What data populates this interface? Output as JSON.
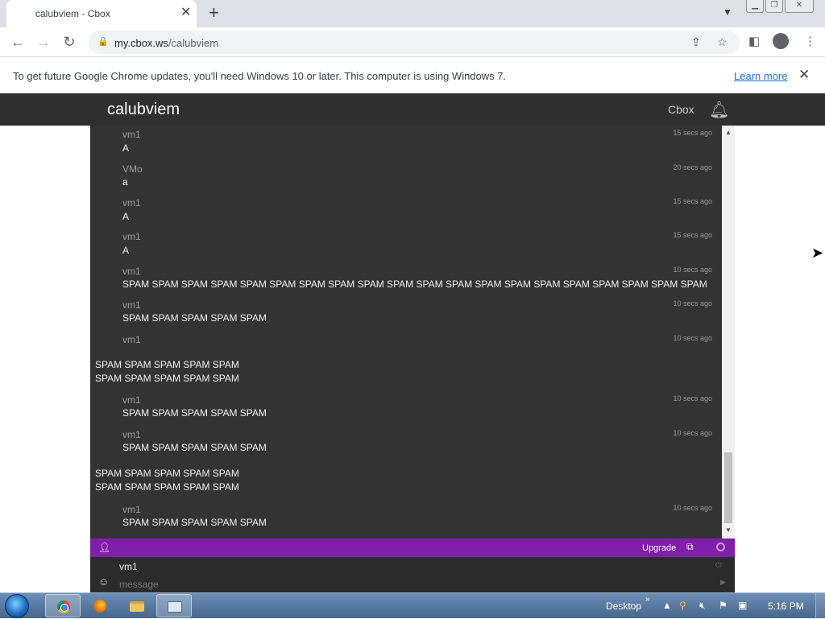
{
  "browser": {
    "tab_title": "calubviem - Cbox",
    "tab_close": "✕",
    "new_tab": "+",
    "url_host": "my.cbox.ws",
    "url_path": "/calubviem",
    "infobar_text": "To get future Google Chrome updates, you'll need Windows 10 or later. This computer is using Windows 7.",
    "infobar_link": "Learn more"
  },
  "site": {
    "title": "calubviem",
    "nav_link": "Cbox"
  },
  "messages": [
    {
      "nick": "vm1",
      "time": "15 secs ago",
      "body": "A"
    },
    {
      "nick": "VMo",
      "time": "20 secs ago",
      "body": "a"
    },
    {
      "nick": "vm1",
      "time": "15 secs ago",
      "body": "A"
    },
    {
      "nick": "vm1",
      "time": "15 secs ago",
      "body": "A"
    },
    {
      "nick": "vm1",
      "time": "10 secs ago",
      "body": "SPAM SPAM SPAM SPAM SPAM SPAM SPAM SPAM SPAM SPAM SPAM SPAM SPAM SPAM SPAM SPAM SPAM SPAM SPAM SPAM"
    },
    {
      "nick": "vm1",
      "time": "10 secs ago",
      "body": "SPAM SPAM SPAM SPAM SPAM"
    },
    {
      "nick": "vm1",
      "time": "10 secs ago",
      "body": ""
    },
    {
      "nick": "vm1",
      "time": "10 secs ago",
      "body": "SPAM SPAM SPAM SPAM SPAM"
    },
    {
      "nick": "vm1",
      "time": "10 secs ago",
      "body": "SPAM SPAM SPAM SPAM SPAM"
    },
    {
      "nick": "vm1",
      "time": "10 secs ago",
      "body": "SPAM SPAM SPAM SPAM SPAM"
    }
  ],
  "free_lines": [
    "SPAM SPAM SPAM SPAM SPAM",
    "SPAM SPAM SPAM SPAM SPAM",
    "SPAM SPAM SPAM SPAM SPAM",
    "SPAM SPAM SPAM SPAM SPAM"
  ],
  "chat_bar": {
    "upgrade_label": "Upgrade"
  },
  "input": {
    "nick_value": "vm1",
    "message_placeholder": "message"
  },
  "taskbar": {
    "desktop_label": "Desktop",
    "clock": "5:16 PM"
  },
  "colors": {
    "header_bg": "#2f2f2f",
    "chat_bg": "#333333",
    "accent_purple": "#7e1ea9"
  }
}
